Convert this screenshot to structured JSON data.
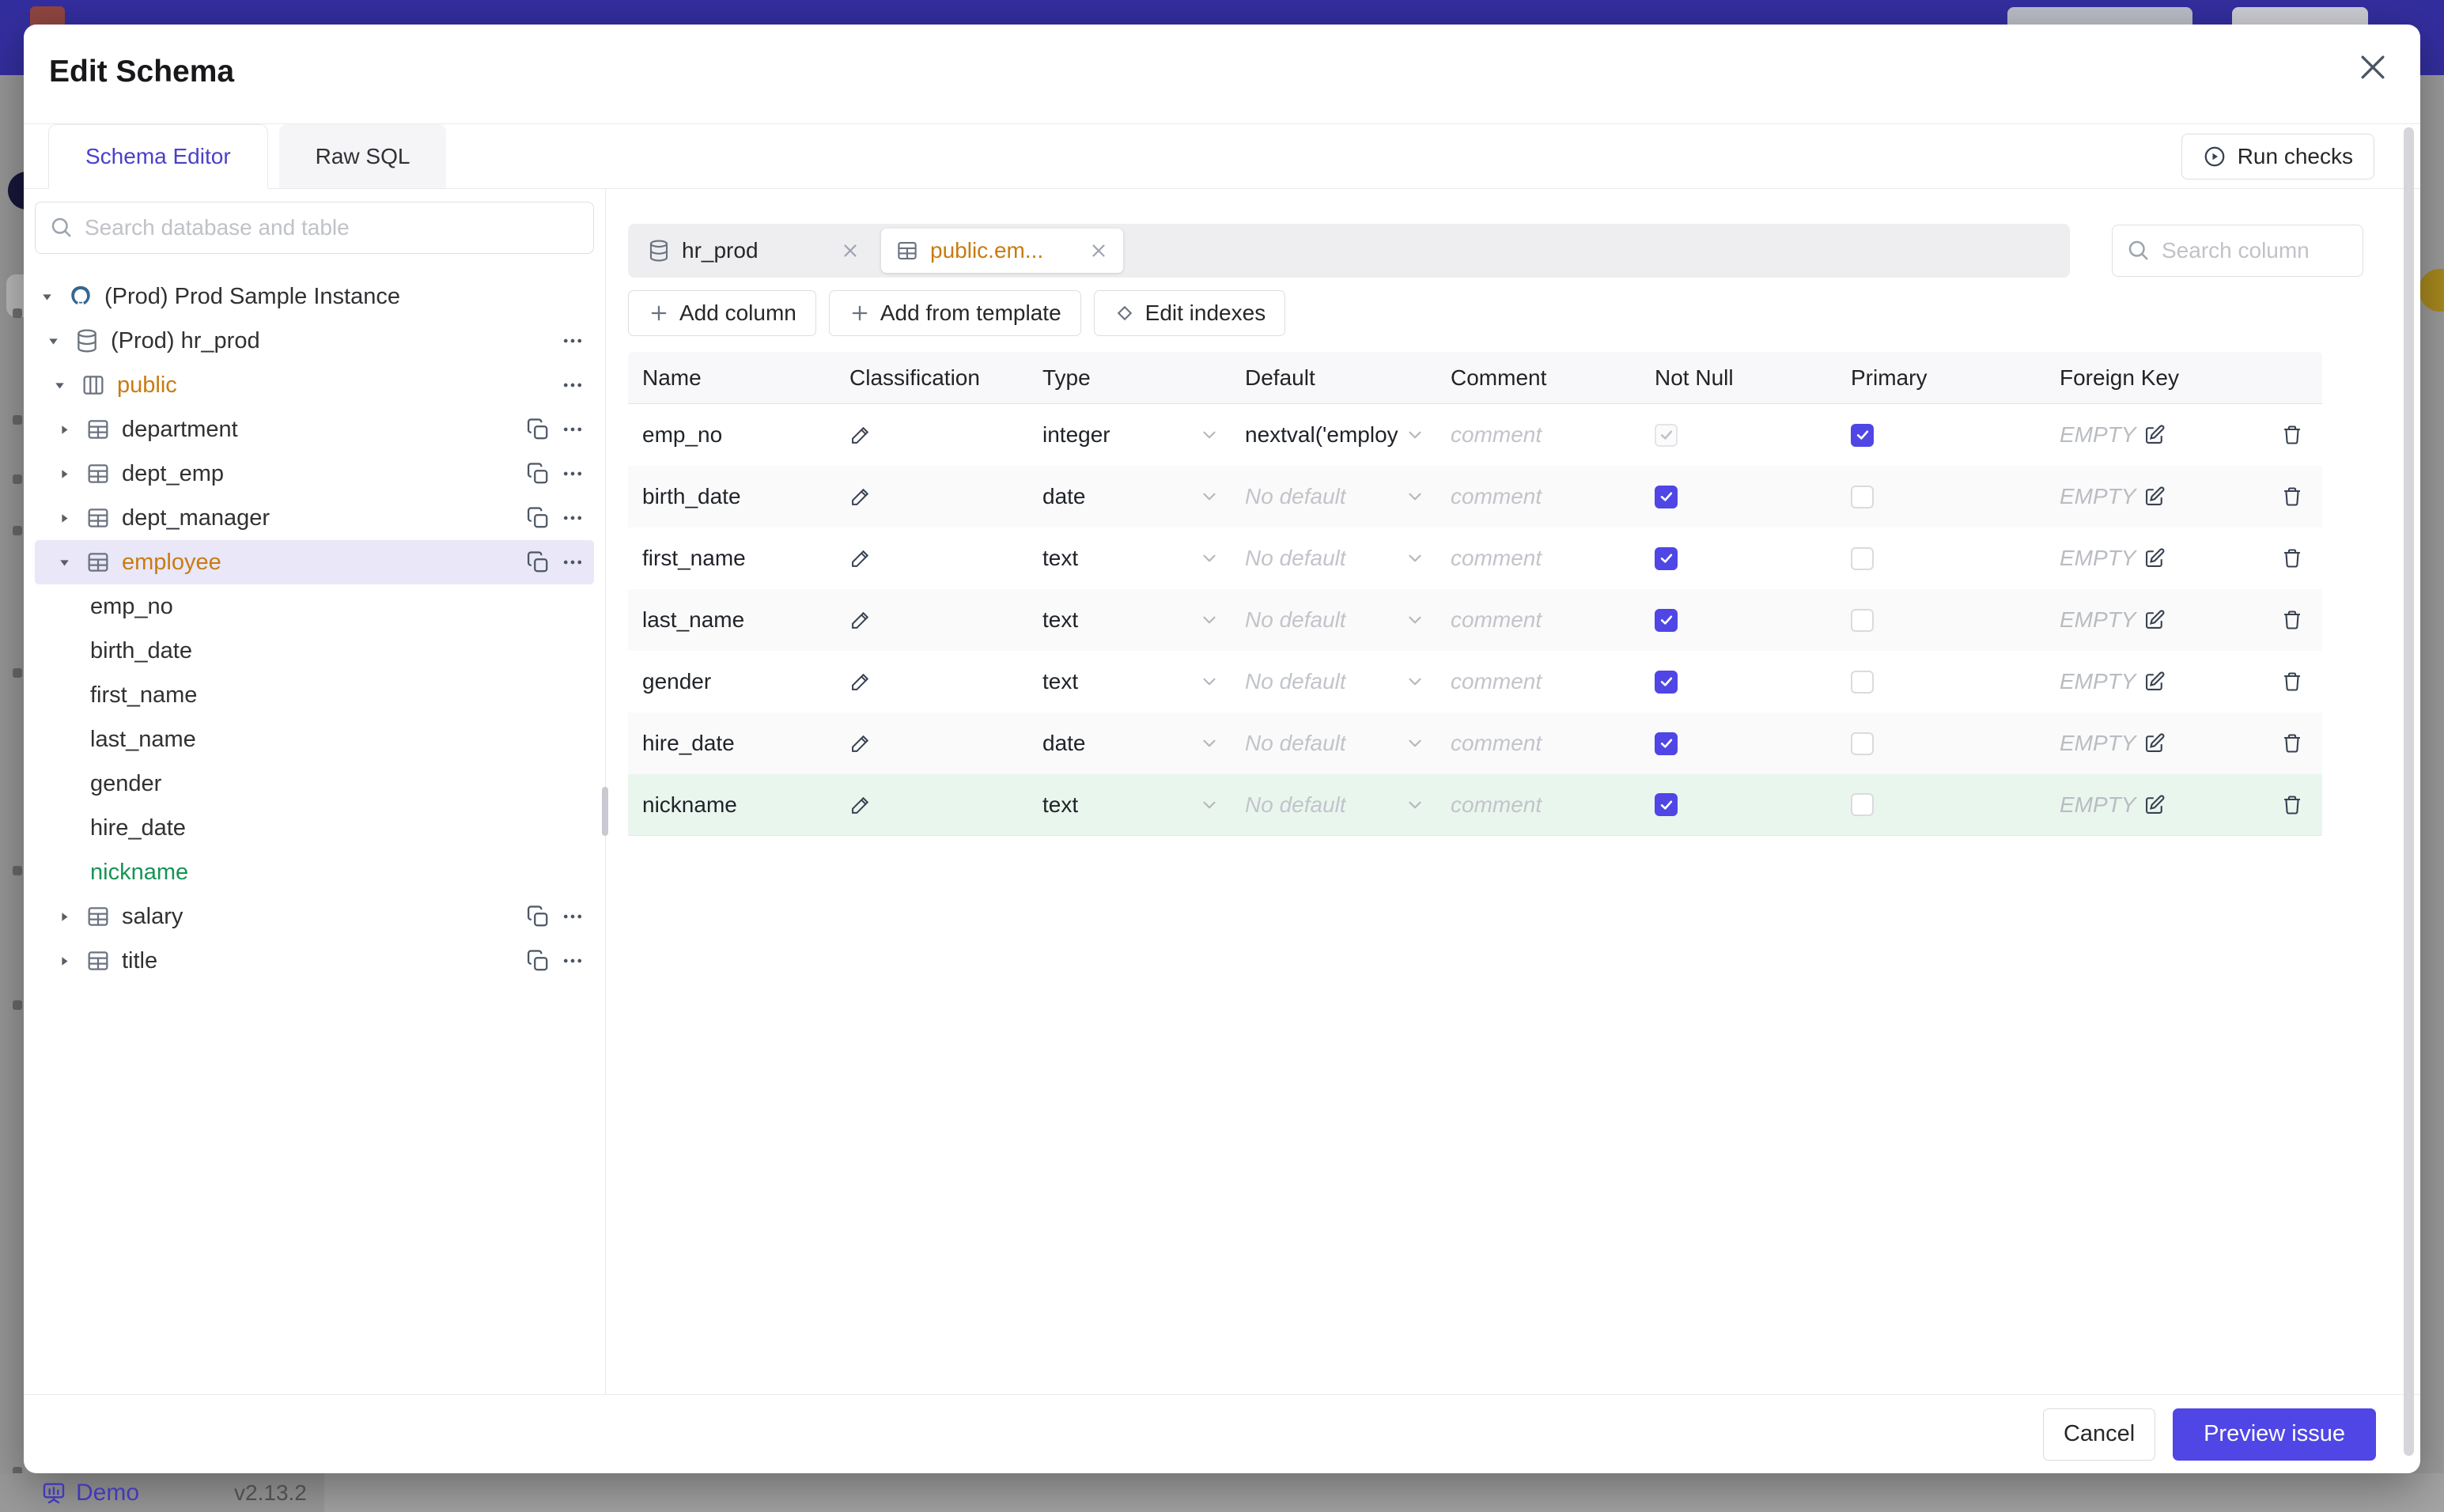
{
  "app": {
    "demo_label": "Demo",
    "version": "v2.13.2",
    "header_color": "#332e9e",
    "accent_color": "#4f46e5"
  },
  "modal": {
    "title": "Edit Schema",
    "tabs": [
      {
        "label": "Schema Editor",
        "active": true
      },
      {
        "label": "Raw SQL",
        "active": false
      }
    ],
    "run_checks_label": "Run checks",
    "sidebar": {
      "search_placeholder": "Search database and table",
      "tree": [
        {
          "level": 1,
          "caret": "down",
          "icon": "postgres",
          "label": "(Prod) Prod Sample Instance",
          "actions": []
        },
        {
          "level": 2,
          "caret": "down",
          "icon": "database",
          "label": "(Prod) hr_prod",
          "actions": [
            "more"
          ]
        },
        {
          "level": 3,
          "caret": "down",
          "icon": "schema",
          "label": "public",
          "color": "orange",
          "actions": [
            "more"
          ]
        },
        {
          "level": 4,
          "caret": "right",
          "icon": "table",
          "label": "department",
          "actions": [
            "copy",
            "more"
          ]
        },
        {
          "level": 4,
          "caret": "right",
          "icon": "table",
          "label": "dept_emp",
          "actions": [
            "copy",
            "more"
          ]
        },
        {
          "level": 4,
          "caret": "right",
          "icon": "table",
          "label": "dept_manager",
          "actions": [
            "copy",
            "more"
          ]
        },
        {
          "level": 4,
          "caret": "down",
          "icon": "table",
          "label": "employee",
          "color": "orange",
          "selected": true,
          "actions": [
            "copy",
            "more"
          ]
        },
        {
          "level": 5,
          "label": "emp_no"
        },
        {
          "level": 5,
          "label": "birth_date"
        },
        {
          "level": 5,
          "label": "first_name"
        },
        {
          "level": 5,
          "label": "last_name"
        },
        {
          "level": 5,
          "label": "gender"
        },
        {
          "level": 5,
          "label": "hire_date"
        },
        {
          "level": 5,
          "label": "nickname",
          "color": "green"
        },
        {
          "level": 4,
          "caret": "right",
          "icon": "table",
          "label": "salary",
          "actions": [
            "copy",
            "more"
          ]
        },
        {
          "level": 4,
          "caret": "right",
          "icon": "table",
          "label": "title",
          "actions": [
            "copy",
            "more"
          ]
        }
      ]
    },
    "editor": {
      "chips": [
        {
          "label": "hr_prod",
          "icon": "database",
          "active": false
        },
        {
          "label": "public.em...",
          "icon": "table",
          "active": true
        }
      ],
      "search_placeholder": "Search column",
      "toolbar": [
        {
          "label": "Add column",
          "icon": "plus"
        },
        {
          "label": "Add from template",
          "icon": "plus"
        },
        {
          "label": "Edit indexes",
          "icon": "diamond"
        }
      ],
      "table": {
        "headers": [
          "Name",
          "Classification",
          "Type",
          "Default",
          "Comment",
          "Not Null",
          "Primary",
          "Foreign Key"
        ],
        "comment_placeholder": "comment",
        "fk_empty_label": "EMPTY",
        "rows": [
          {
            "name": "emp_no",
            "type": "integer",
            "default": "nextval('employ",
            "default_is_placeholder": false,
            "not_null": "checked-disabled",
            "primary": "checked",
            "highlight": "none"
          },
          {
            "name": "birth_date",
            "type": "date",
            "default": "No default",
            "default_is_placeholder": true,
            "not_null": "checked",
            "primary": "unchecked",
            "highlight": "stripe"
          },
          {
            "name": "first_name",
            "type": "text",
            "default": "No default",
            "default_is_placeholder": true,
            "not_null": "checked",
            "primary": "unchecked",
            "highlight": "none"
          },
          {
            "name": "last_name",
            "type": "text",
            "default": "No default",
            "default_is_placeholder": true,
            "not_null": "checked",
            "primary": "unchecked",
            "highlight": "stripe"
          },
          {
            "name": "gender",
            "type": "text",
            "default": "No default",
            "default_is_placeholder": true,
            "not_null": "checked",
            "primary": "unchecked",
            "highlight": "none"
          },
          {
            "name": "hire_date",
            "type": "date",
            "default": "No default",
            "default_is_placeholder": true,
            "not_null": "checked",
            "primary": "unchecked",
            "highlight": "stripe"
          },
          {
            "name": "nickname",
            "type": "text",
            "default": "No default",
            "default_is_placeholder": true,
            "not_null": "checked",
            "primary": "unchecked",
            "highlight": "new"
          }
        ]
      }
    },
    "footer": {
      "cancel_label": "Cancel",
      "primary_label": "Preview issue"
    }
  }
}
